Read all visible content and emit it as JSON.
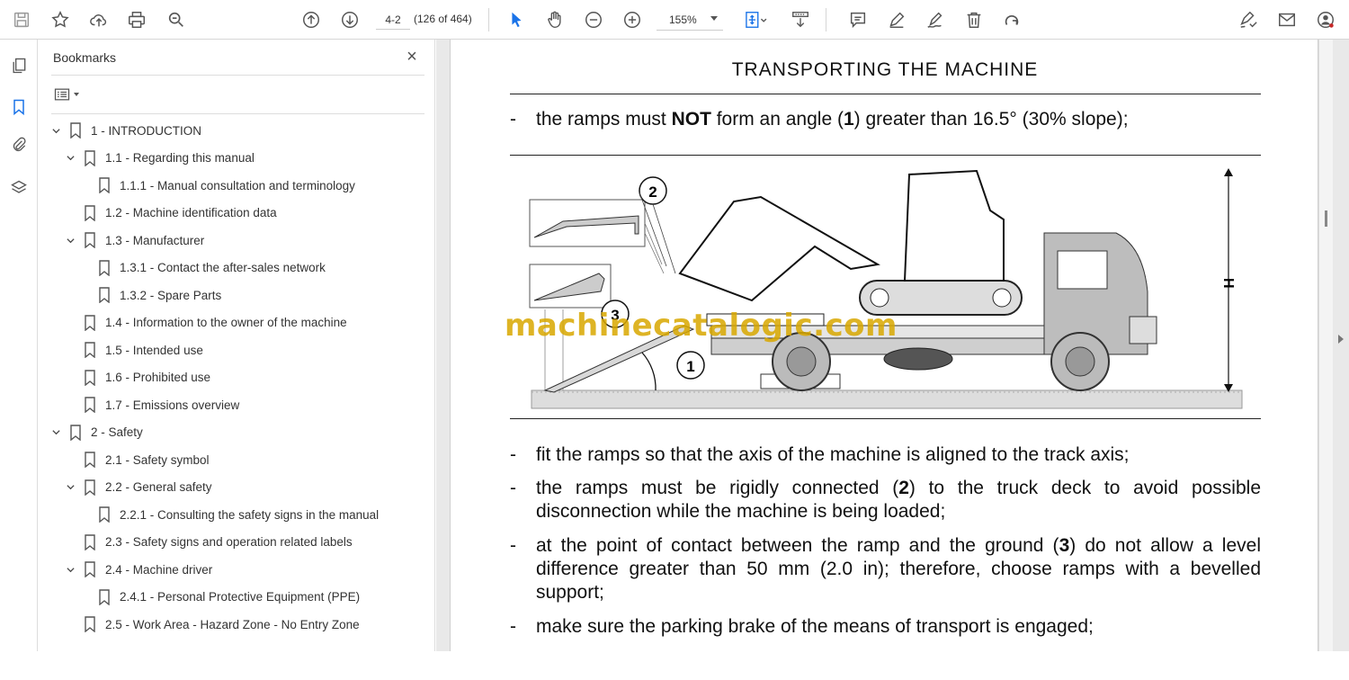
{
  "toolbar": {
    "page_current": "4-2",
    "page_count": "(126 of 464)",
    "zoom": "155%",
    "icons": [
      "save-icon",
      "star-icon",
      "upload-cloud-icon",
      "print-icon",
      "search-icon",
      "page-up-icon",
      "page-down-icon",
      "zoom-out-icon",
      "zoom-in-icon",
      "select-arrow-icon",
      "hand-icon",
      "fit-page-icon",
      "scroll-mode-icon",
      "comment-icon",
      "highlight-pen-icon",
      "sign-pen-icon",
      "delete-icon",
      "rotate-icon",
      "fill-sign-icon",
      "mail-icon",
      "account-icon"
    ]
  },
  "panel": {
    "title": "Bookmarks",
    "bookmarks": [
      {
        "label": "1 -  INTRODUCTION",
        "level": 0,
        "expanded": true
      },
      {
        "label": "1.1 - Regarding this manual",
        "level": 1,
        "expanded": true
      },
      {
        "label": "1.1.1 - Manual consultation and terminology",
        "level": 2,
        "expanded": null
      },
      {
        "label": "1.2 - Machine identification data",
        "level": 1,
        "expanded": null
      },
      {
        "label": "1.3 - Manufacturer",
        "level": 1,
        "expanded": true
      },
      {
        "label": "1.3.1 - Contact the after-sales network",
        "level": 2,
        "expanded": null
      },
      {
        "label": "1.3.2 - Spare Parts",
        "level": 2,
        "expanded": null
      },
      {
        "label": "1.4 - Information to the owner of the machine",
        "level": 1,
        "expanded": null
      },
      {
        "label": "1.5 - Intended use",
        "level": 1,
        "expanded": null
      },
      {
        "label": "1.6 - Prohibited use",
        "level": 1,
        "expanded": null
      },
      {
        "label": "1.7 - Emissions overview",
        "level": 1,
        "expanded": null
      },
      {
        "label": "2 -  Safety",
        "level": 0,
        "expanded": true
      },
      {
        "label": "2.1 - Safety symbol",
        "level": 1,
        "expanded": null
      },
      {
        "label": "2.2 - General safety",
        "level": 1,
        "expanded": true
      },
      {
        "label": "2.2.1 - Consulting the safety signs in the manual",
        "level": 2,
        "expanded": null
      },
      {
        "label": "2.3 - Safety signs and operation related labels",
        "level": 1,
        "expanded": null
      },
      {
        "label": "2.4 - Machine driver",
        "level": 1,
        "expanded": true
      },
      {
        "label": "2.4.1 - Personal Protective Equipment (PPE)",
        "level": 2,
        "expanded": null
      },
      {
        "label": "2.5 - Work Area - Hazard Zone - No Entry Zone",
        "level": 1,
        "expanded": null
      }
    ]
  },
  "document": {
    "title": "TRANSPORTING THE MACHINE",
    "bullet1_pre": "the ramps must ",
    "bullet1_bold": "NOT",
    "bullet1_mid": " form an angle (",
    "bullet1_num": "1",
    "bullet1_post": ") greater than 16.5° (30% slope);",
    "bullet2": "fit the ramps so that the axis of the machine is aligned to the track axis;",
    "bullet3_pre": "the ramps must be rigidly connected (",
    "bullet3_num": "2",
    "bullet3_post": ") to the truck deck to avoid possible disconnection while the machine is being loaded;",
    "bullet4_pre": "at the point of contact between the ramp and the ground (",
    "bullet4_num": "3",
    "bullet4_post": ") do not allow a level difference greater than 50 mm (2.0 in); therefore, choose ramps with a bevelled support;",
    "bullet5": "make sure the parking brake of the means of transport is engaged;",
    "dash": "-",
    "figure": {
      "callout_1": "1",
      "callout_2": "2",
      "callout_3": "3",
      "height_label": "H"
    },
    "watermark": "machinecatalogic.com"
  }
}
